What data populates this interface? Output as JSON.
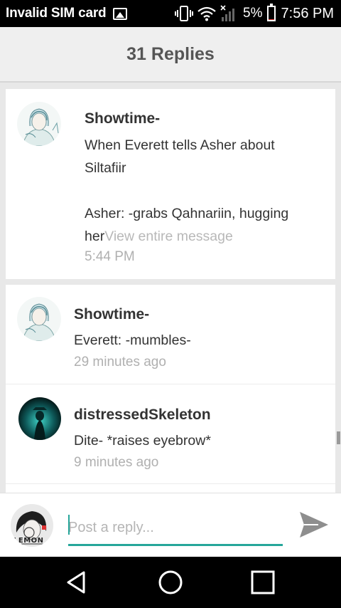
{
  "status_bar": {
    "carrier": "Invalid SIM card",
    "battery_percent": "5%",
    "battery_level": 0.05,
    "time": "7:56 PM",
    "icons": [
      "image-notification-icon",
      "vibrate-icon",
      "wifi-icon",
      "no-signal-icon",
      "battery-icon"
    ]
  },
  "header": {
    "title": "31 Replies"
  },
  "replies": [
    {
      "author": "Showtime-",
      "message": "When Everett tells Asher about Siltafiir",
      "message_2": "Asher: -grabs Qahnariin, hugging",
      "message_3": "her",
      "view_more": "View entire message",
      "time": "5:44 PM"
    },
    {
      "author": "Showtime-",
      "message": "Everett: -mumbles-",
      "time": "29 minutes ago"
    },
    {
      "author": "distressedSkeleton",
      "message": "Dite- *raises eyebrow*",
      "time": "9 minutes ago"
    }
  ],
  "composer": {
    "placeholder": "Post a reply...",
    "value": "",
    "avatar_text": "LEMON",
    "accent": "#26a69a"
  },
  "nav": {
    "icons": [
      "back-icon",
      "home-icon",
      "recents-icon"
    ]
  }
}
